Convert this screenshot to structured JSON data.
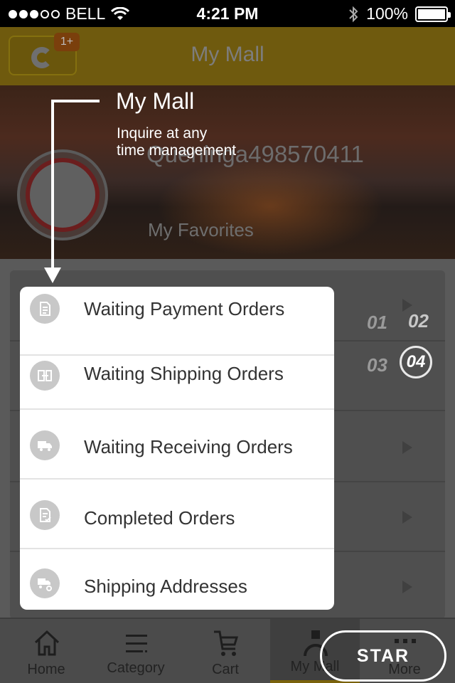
{
  "status_bar": {
    "carrier": "BELL",
    "time": "4:21 PM",
    "battery": "100%"
  },
  "header": {
    "title": "My Mall",
    "badge": "1+"
  },
  "profile": {
    "username": "Queninga498570411",
    "favorites_label": "My Favorites"
  },
  "coach": {
    "title": "My Mall",
    "desc_line1": "Inquire at any",
    "desc_line2": "time management",
    "step_numbers": [
      "01",
      "02",
      "03",
      "04"
    ],
    "current_step": "04"
  },
  "menu": {
    "items": [
      {
        "label": "Waiting Payment Orders",
        "icon": "document-icon"
      },
      {
        "label": "Waiting Shipping Orders",
        "icon": "transfer-icon"
      },
      {
        "label": "Waiting Receiving Orders",
        "icon": "truck-icon"
      },
      {
        "label": "Completed Orders",
        "icon": "document-check-icon"
      },
      {
        "label": "Shipping Addresses",
        "icon": "truck-gear-icon"
      }
    ]
  },
  "tabbar": {
    "tabs": [
      {
        "label": "Home",
        "icon": "home-icon"
      },
      {
        "label": "Category",
        "icon": "list-icon"
      },
      {
        "label": "Cart",
        "icon": "cart-icon"
      },
      {
        "label": "My Mall",
        "icon": "user-icon"
      },
      {
        "label": "More",
        "icon": "more-icon"
      }
    ],
    "active": "My Mall"
  },
  "star_button": {
    "label": "STAR"
  }
}
